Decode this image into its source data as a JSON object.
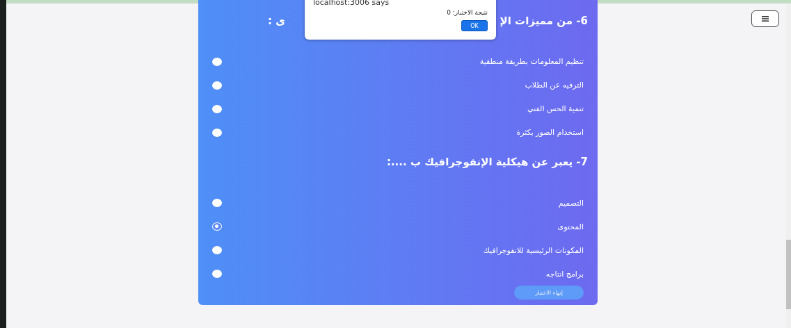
{
  "questions": [
    {
      "heading_parts": [
        "6- من مميزات الإ",
        "ى :"
      ],
      "options": [
        {
          "label": "تنظيم المعلومات بطريقة منطقية",
          "selected": false
        },
        {
          "label": "الترفيه عن الطلاب",
          "selected": false
        },
        {
          "label": "تنمية الحس الفني",
          "selected": false
        },
        {
          "label": "استخدام الصور بكثرة",
          "selected": false
        }
      ]
    },
    {
      "heading_parts": [
        "7- يعبر عن هيكلية الإنفوجرافيك ب ....:"
      ],
      "options": [
        {
          "label": "التصميم",
          "selected": false
        },
        {
          "label": "المحتوى",
          "selected": true
        },
        {
          "label": "المكونات الرئيسية للانفوجرافيك",
          "selected": false
        },
        {
          "label": "برامج انتاجه",
          "selected": false
        }
      ]
    }
  ],
  "finish_button": "إنهاء الاختبار",
  "dialog": {
    "title": "localhost:3006 says",
    "message": "نتيجة الاختبار: 0",
    "ok": "OK"
  }
}
